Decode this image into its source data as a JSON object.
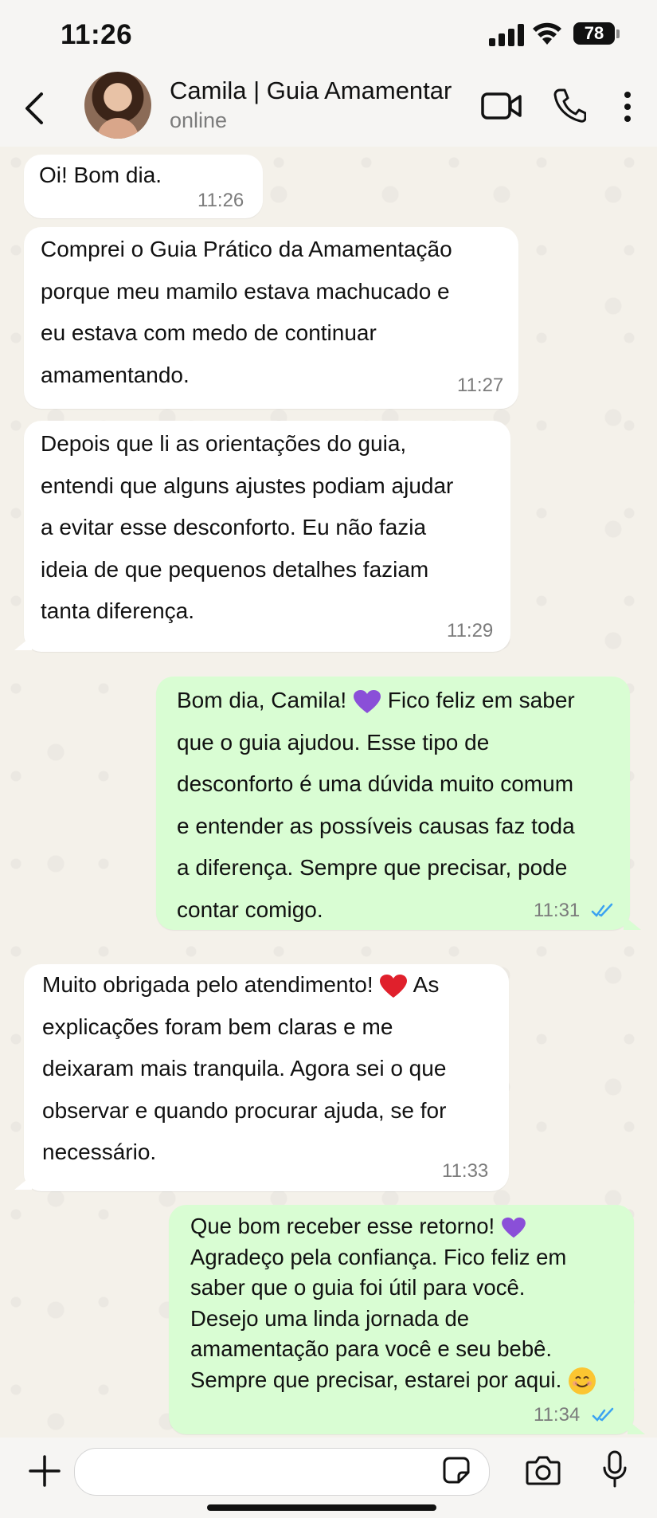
{
  "status_bar": {
    "time": "11:26",
    "battery": "78"
  },
  "header": {
    "contact_name": "Camila | Guia Amamentar",
    "contact_status": "online"
  },
  "messages": [
    {
      "direction": "in",
      "text": "Oi! Bom dia.",
      "time": "11:26"
    },
    {
      "direction": "in",
      "text": "Comprei o Guia Prático da Amamentação\nporque meu mamilo estava machucado e\neu estava com medo de continuar\namamentando.",
      "time": "11:27"
    },
    {
      "direction": "in",
      "text": "Depois que li as orientações do guia,\nentendi que alguns ajustes podiam ajudar\na evitar esse desconforto. Eu não fazia\nideia de que pequenos detalhes faziam\ntanta diferença.",
      "time": "11:29"
    },
    {
      "direction": "out",
      "text_before": "Bom dia, Camila!",
      "text_after": "Fico feliz em saber\nque o guia ajudou. Esse tipo de\ndesconforto é uma dúvida muito comum\ne entender as possíveis causas faz toda\na diferença. Sempre que precisar, pode\ncontar comigo.",
      "emoji": "purple-heart",
      "time": "11:31",
      "status": "read"
    },
    {
      "direction": "in",
      "text_before": "Muito obrigada pelo atendimento!",
      "text_after": "As\nexplicações foram bem claras e me\ndeixaram mais tranquila. Agora sei o que\nobservar e quando procurar ajuda, se for\nnecessário.",
      "emoji": "red-heart",
      "time": "11:33"
    },
    {
      "direction": "out",
      "text_before": "Que bom receber esse retorno!",
      "text_after": "\nAgradeço pela confiança. Fico feliz em\nsaber que o guia foi útil para você.\nDesejo uma linda jornada de\namamentação para você e seu bebê.\nSempre que precisar, estarei por aqui.",
      "emoji": "purple-heart",
      "emoji_end": "smiling-face",
      "time": "11:34",
      "status": "read"
    }
  ],
  "input": {
    "placeholder": ""
  },
  "colors": {
    "incoming": "#ffffff",
    "outgoing": "#d9fdd3",
    "read_ticks": "#3aa2f1",
    "background": "#f4f1ea"
  }
}
